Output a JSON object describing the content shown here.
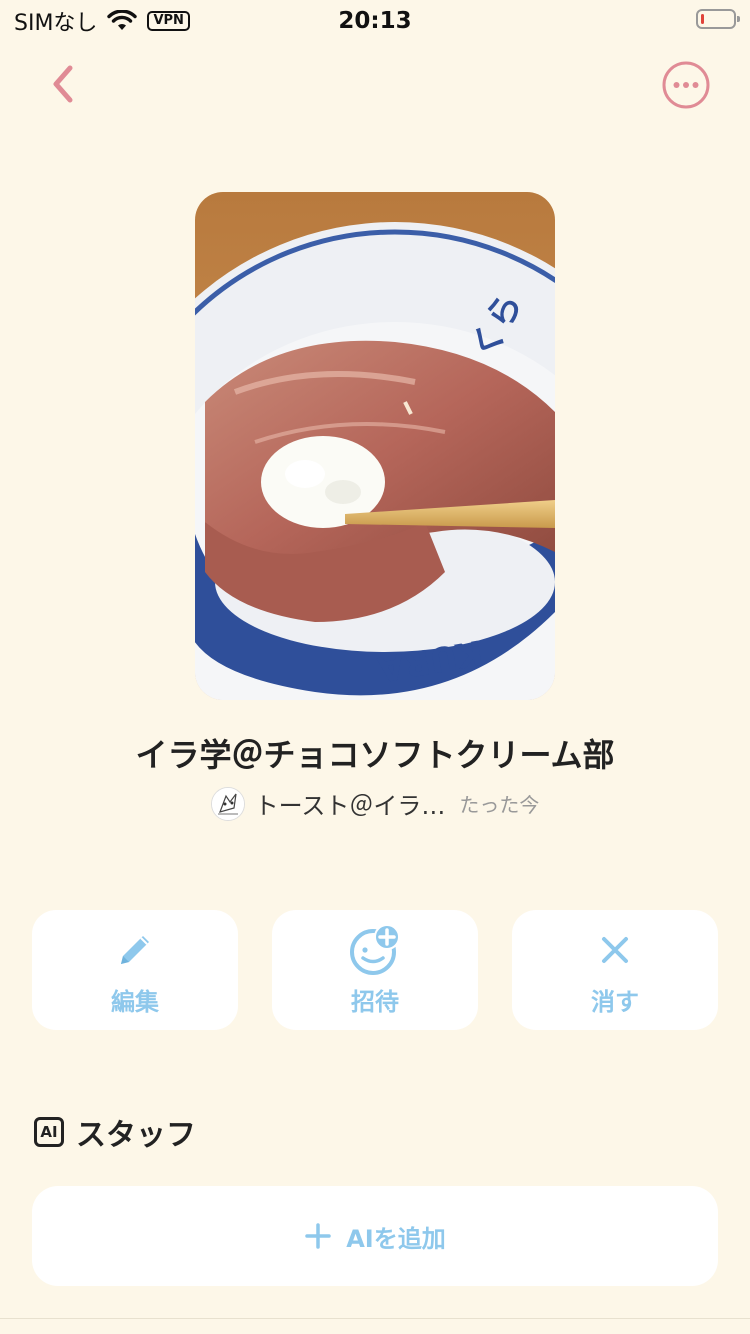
{
  "status_bar": {
    "carrier": "SIMなし",
    "vpn": "VPN",
    "time": "20:13",
    "battery_level": 0.1,
    "battery_color": "#e0433a"
  },
  "nav": {
    "back_icon": "chevron-left-icon",
    "more_icon": "more-horizontal-circle-icon",
    "accent_color": "#e08b95"
  },
  "group": {
    "title": "イラ学＠チョコソフトクリーム部",
    "creator_name": "トースト＠イラ…",
    "created_time": "たった今"
  },
  "actions": [
    {
      "label": "編集",
      "icon": "pencil-icon"
    },
    {
      "label": "招待",
      "icon": "add-person-icon"
    },
    {
      "label": "消す",
      "icon": "close-icon"
    }
  ],
  "staff": {
    "badge": "AI",
    "title": "スタッフ",
    "add_label": "AIを追加"
  },
  "colors": {
    "background": "#fdf7e8",
    "action_blue": "#8ec8ec"
  }
}
